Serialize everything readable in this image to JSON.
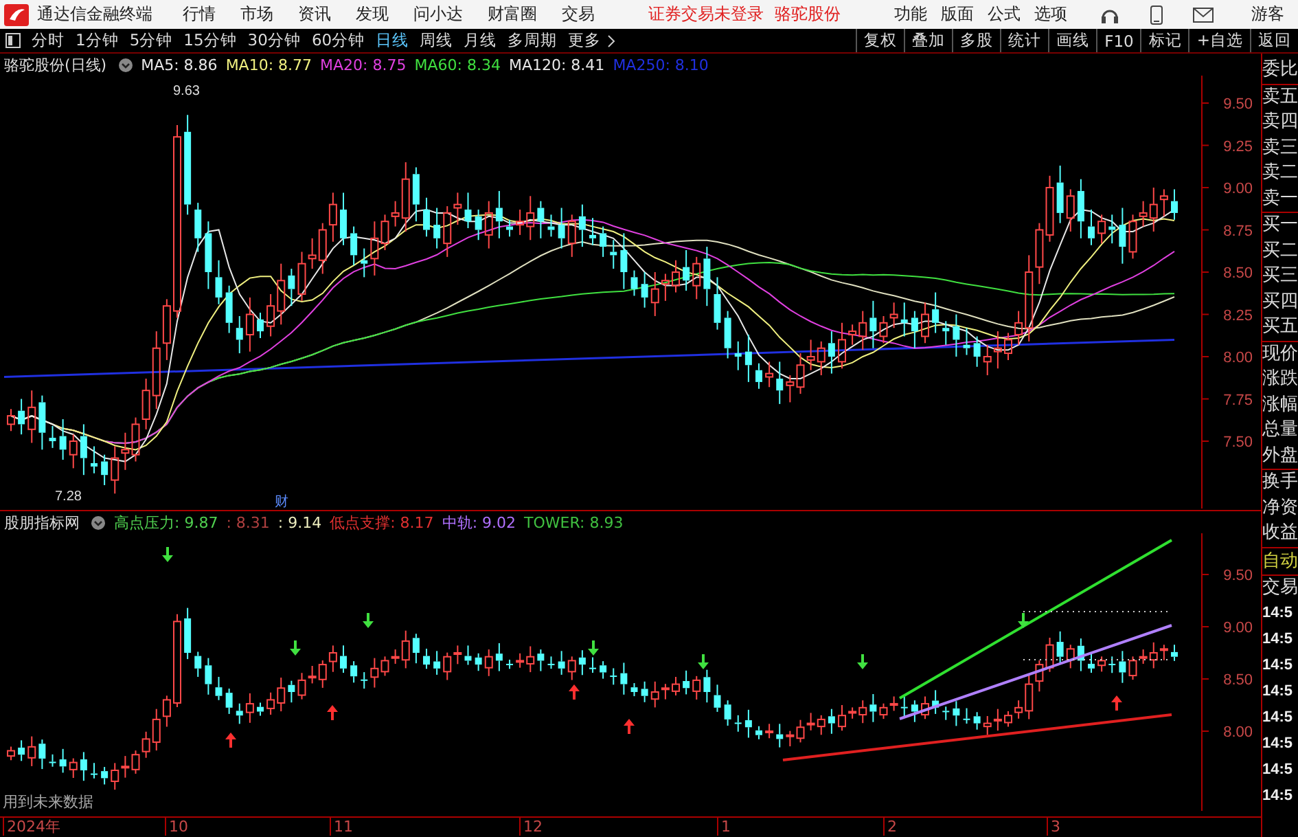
{
  "app_bar": {
    "app_name": "通达信金融终端",
    "menu": [
      "行情",
      "市场",
      "资讯",
      "发现",
      "问小达",
      "财富圈",
      "交易"
    ],
    "notice": "证券交易未登录",
    "stock": "骆驼股份",
    "right_menu": [
      "功能",
      "版面",
      "公式",
      "选项"
    ],
    "user": "游客"
  },
  "period_tabs": [
    {
      "label": "分时",
      "selected": false
    },
    {
      "label": "1分钟",
      "selected": false
    },
    {
      "label": "5分钟",
      "selected": false
    },
    {
      "label": "15分钟",
      "selected": false
    },
    {
      "label": "30分钟",
      "selected": false
    },
    {
      "label": "60分钟",
      "selected": false
    },
    {
      "label": "日线",
      "selected": true
    },
    {
      "label": "周线",
      "selected": false
    },
    {
      "label": "月线",
      "selected": false
    },
    {
      "label": "多周期",
      "selected": false
    },
    {
      "label": "更多",
      "selected": false
    }
  ],
  "tools": [
    "复权",
    "叠加",
    "多股",
    "统计",
    "画线",
    "F10",
    "标记",
    "+自选",
    "返回"
  ],
  "main_chart": {
    "title": "骆驼股份(日线)",
    "indicators": [
      {
        "label": "MA5: 8.86",
        "color": "#e8e8e8"
      },
      {
        "label": "MA10: 8.77",
        "color": "#f0f080"
      },
      {
        "label": "MA20: 8.75",
        "color": "#e040e0"
      },
      {
        "label": "MA60: 8.34",
        "color": "#40e040"
      },
      {
        "label": "MA120: 8.41",
        "color": "#e8e8e8"
      },
      {
        "label": "MA250: 8.10",
        "color": "#2030e0"
      }
    ],
    "y_ticks": [
      "9.50",
      "9.25",
      "9.00",
      "8.75",
      "8.50",
      "8.25",
      "8.00",
      "7.75",
      "7.50"
    ],
    "high_label": "9.63",
    "low_label": "7.28",
    "event_mark": "财"
  },
  "sub_chart": {
    "title": "股朋指标网",
    "indicators": [
      {
        "label": "高点压力: 9.87",
        "color": "#50d050"
      },
      {
        "label": ": 8.31",
        "color": "#b04040"
      },
      {
        "label": ": 9.14",
        "color": "#f0f0c0"
      },
      {
        "label": "低点支撑: 8.17",
        "color": "#e03030"
      },
      {
        "label": "中轨: 9.02",
        "color": "#b070ff"
      },
      {
        "label": "TOWER: 8.93",
        "color": "#40c040"
      }
    ],
    "y_ticks": [
      "9.50",
      "9.00",
      "8.50",
      "8.00"
    ],
    "note": "用到未来数据"
  },
  "x_axis": [
    "2024年",
    "10",
    "11",
    "12",
    "1",
    "2",
    "3"
  ],
  "side_panel": {
    "groups": [
      [
        "委比"
      ],
      [
        "卖五",
        "卖四",
        "卖三",
        "卖二",
        "卖一"
      ],
      [
        "买一",
        "买二",
        "买三",
        "买四",
        "买五"
      ],
      [
        "现价",
        "涨跌",
        "涨幅",
        "总量",
        "外盘"
      ],
      [
        "换手",
        "净资",
        "收益"
      ]
    ],
    "auto": "自动",
    "trades_label": "交易",
    "times": [
      "14:5",
      "14:5",
      "14:5",
      "14:5",
      "14:5",
      "14:5",
      "14:5",
      "14:5"
    ]
  }
}
